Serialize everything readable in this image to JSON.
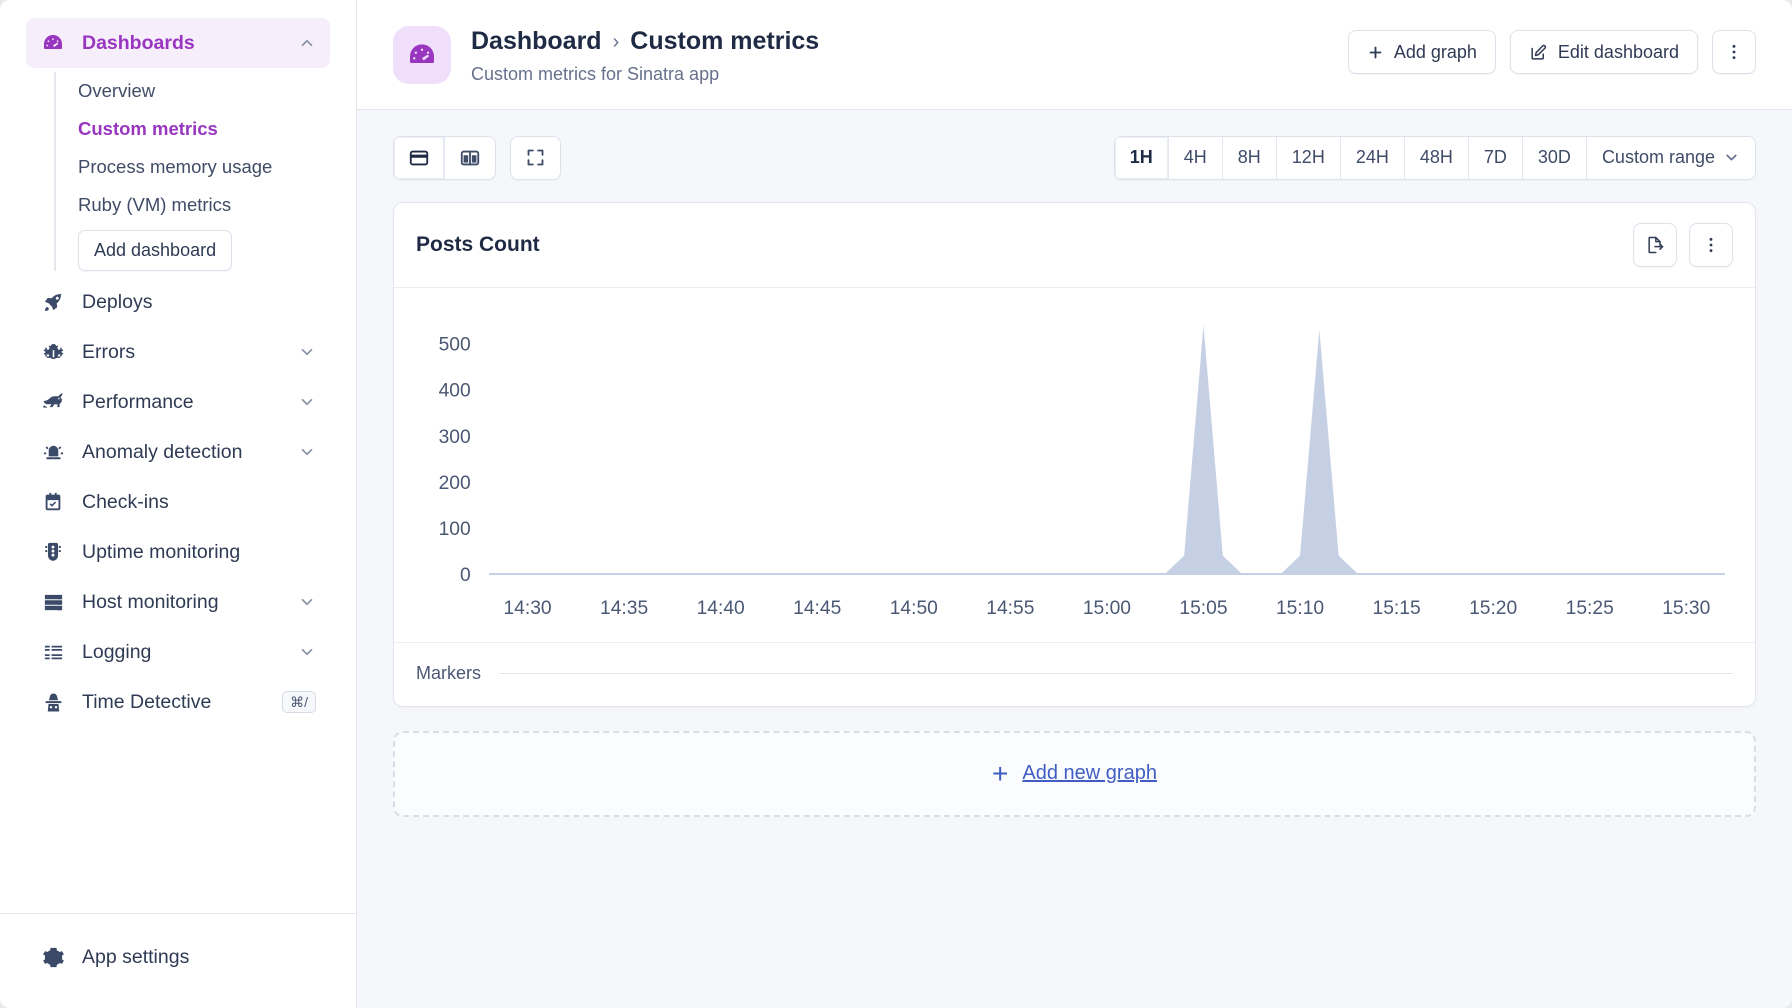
{
  "sidebar": {
    "dashboards": {
      "label": "Dashboards",
      "icon": "gauge-icon",
      "expanded": true,
      "items": [
        {
          "label": "Overview",
          "current": false
        },
        {
          "label": "Custom metrics",
          "current": true
        },
        {
          "label": "Process memory usage",
          "current": false
        },
        {
          "label": "Ruby (VM) metrics",
          "current": false
        }
      ],
      "add_button": "Add dashboard"
    },
    "items": [
      {
        "label": "Deploys",
        "icon": "rocket-icon",
        "chevron": false
      },
      {
        "label": "Errors",
        "icon": "bug-icon",
        "chevron": true
      },
      {
        "label": "Performance",
        "icon": "rabbit-icon",
        "chevron": true
      },
      {
        "label": "Anomaly detection",
        "icon": "siren-icon",
        "chevron": true
      },
      {
        "label": "Check-ins",
        "icon": "calendar-check-icon",
        "chevron": false
      },
      {
        "label": "Uptime monitoring",
        "icon": "traffic-light-icon",
        "chevron": false
      },
      {
        "label": "Host monitoring",
        "icon": "server-icon",
        "chevron": true
      },
      {
        "label": "Logging",
        "icon": "list-icon",
        "chevron": true
      },
      {
        "label": "Time Detective",
        "icon": "detective-icon",
        "chevron": false,
        "shortcut": "⌘/"
      }
    ],
    "footer": {
      "label": "App settings",
      "icon": "gear-icon"
    }
  },
  "header": {
    "avatar_icon": "gauge-icon",
    "breadcrumb_root": "Dashboard",
    "breadcrumb_separator": "›",
    "breadcrumb_current": "Custom metrics",
    "subtitle": "Custom metrics for Sinatra app",
    "add_graph_label": "Add graph",
    "add_graph_icon": "plus-icon",
    "edit_dashboard_label": "Edit dashboard",
    "edit_dashboard_icon": "pencil-square-icon",
    "more_icon": "kebab-menu-icon"
  },
  "toolbar": {
    "layout_buttons": [
      {
        "name": "single-column-layout",
        "icon": "single-pane-icon",
        "selected": true
      },
      {
        "name": "two-column-layout",
        "icon": "two-pane-icon",
        "selected": false
      }
    ],
    "fullscreen_icon": "fullscreen-icon",
    "ranges": [
      "1H",
      "4H",
      "8H",
      "12H",
      "24H",
      "48H",
      "7D",
      "30D"
    ],
    "selected_range": "1H",
    "custom_range_label": "Custom range",
    "custom_range_icon": "chevron-down-icon"
  },
  "card": {
    "title": "Posts Count",
    "export_icon": "export-icon",
    "more_icon": "kebab-menu-icon",
    "markers_label": "Markers"
  },
  "add_new_graph": {
    "plus": "+",
    "label": "Add new graph"
  },
  "colors": {
    "accent_purple": "#9936c0",
    "accent_purple_bg": "#f7eefb",
    "text_dark": "#1f2a44",
    "text_muted": "#67718c",
    "link_blue": "#3f5dc4",
    "series_fill": "#c6d0e4",
    "panel_bg": "#f6f7fa",
    "border": "#e3e6ee"
  },
  "chart_data": {
    "type": "area",
    "title": "Posts Count",
    "xlabel": "",
    "ylabel": "",
    "ylim": [
      0,
      560
    ],
    "yticks": [
      0,
      100,
      200,
      300,
      400,
      500
    ],
    "xticks": [
      "14:30",
      "14:35",
      "14:40",
      "14:45",
      "14:50",
      "14:55",
      "15:00",
      "15:05",
      "15:10",
      "15:15",
      "15:20",
      "15:25",
      "15:30"
    ],
    "grid": false,
    "legend": "none",
    "series": [
      {
        "name": "Posts Count",
        "fill": "#c6d0e4",
        "x": [
          "14:28",
          "14:30",
          "14:35",
          "14:40",
          "14:45",
          "14:50",
          "14:55",
          "15:00",
          "15:02",
          "15:03",
          "15:04",
          "15:05",
          "15:06",
          "15:07",
          "15:08",
          "15:09",
          "15:10",
          "15:11",
          "15:12",
          "15:13",
          "15:15",
          "15:20",
          "15:25",
          "15:30",
          "15:32"
        ],
        "values": [
          0,
          0,
          0,
          0,
          0,
          0,
          0,
          0,
          0,
          0,
          40,
          540,
          40,
          0,
          0,
          0,
          40,
          530,
          40,
          0,
          0,
          0,
          0,
          0,
          0
        ]
      }
    ]
  }
}
